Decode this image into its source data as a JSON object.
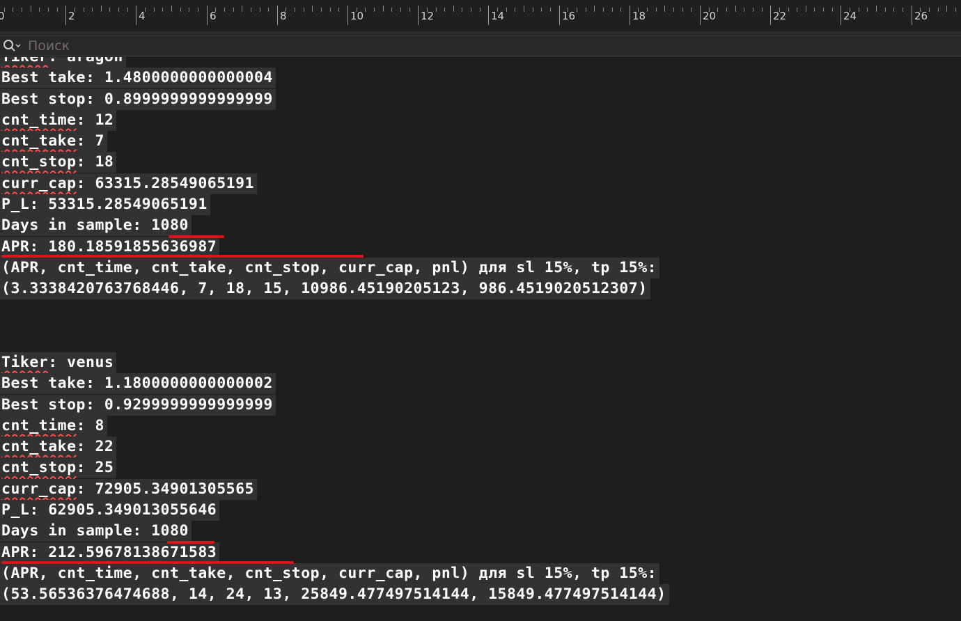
{
  "ruler": {
    "labels": [
      "0",
      "2",
      "4",
      "6",
      "8",
      "10",
      "12",
      "14",
      "16",
      "18",
      "20",
      "22",
      "24",
      "26"
    ]
  },
  "search": {
    "placeholder": "Поиск"
  },
  "blocks": [
    {
      "tiker_label": "Tiker",
      "tiker_value": "aragon",
      "best_take": "Best take: 1.4800000000000004",
      "best_stop": "Best stop: 0.8999999999999999",
      "cnt_time_key": "cnt_time",
      "cnt_time_val": ": 12",
      "cnt_take_key": "cnt_take",
      "cnt_take_val": ": 7",
      "cnt_stop_key": "cnt_stop",
      "cnt_stop_val": ": 18",
      "curr_cap_key": "curr_cap",
      "curr_cap_val": ": 63315.28549065191",
      "pl": "P_L: 53315.28549065191",
      "days": "Days in sample: 1080",
      "apr": "APR: 180.18591855636987",
      "summary_head": "(APR, cnt_time, cnt_take, cnt_stop, curr_cap, pnl) для sl 15%, tp 15%:",
      "summary_vals": "(3.3338420763768446, 7, 18, 15, 10986.45190205123, 986.4519020512307)"
    },
    {
      "tiker_label": "Tiker",
      "tiker_value": "venus",
      "best_take": "Best take: 1.1800000000000002",
      "best_stop": "Best stop: 0.9299999999999999",
      "cnt_time_key": "cnt_time",
      "cnt_time_val": ": 8",
      "cnt_take_key": "cnt_take",
      "cnt_take_val": ": 22",
      "cnt_stop_key": "cnt_stop",
      "cnt_stop_val": ": 25",
      "curr_cap_key": "curr_cap",
      "curr_cap_val": ": 72905.34901305565",
      "pl": "P_L: 62905.349013055646",
      "days": "Days in sample: 1080",
      "apr": "APR: 212.59678138671583",
      "summary_head": "(APR, cnt_time, cnt_take, cnt_stop, curr_cap, pnl) для sl 15%, tp 15%:",
      "summary_vals": "(53.56536376474688, 14, 24, 13, 25849.477497514144, 15849.477497514144)"
    }
  ],
  "colors": {
    "background": "#1e1e1e",
    "line_highlight": "#323232",
    "text": "#ffffff",
    "annotation_red": "#e2111a",
    "spellcheck": "#ff4d4d"
  }
}
